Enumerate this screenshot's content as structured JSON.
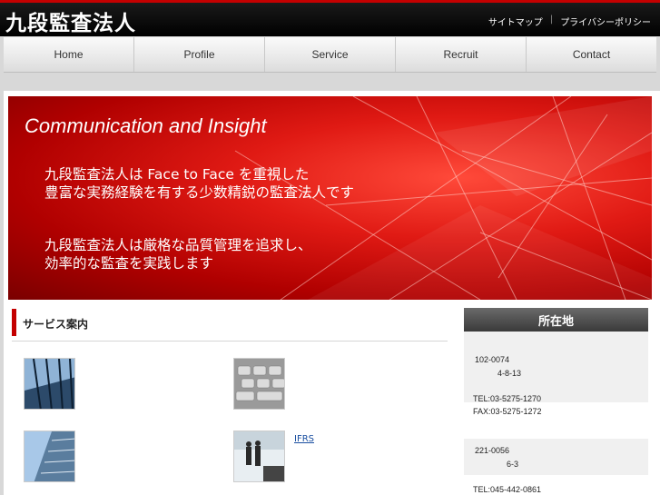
{
  "header": {
    "logo": "九段監査法人",
    "links": [
      "サイトマップ",
      "プライバシーポリシー"
    ]
  },
  "nav": [
    "Home",
    "Profile",
    "Service",
    "Recruit",
    "Contact"
  ],
  "hero": {
    "tagline": "Communication and Insight",
    "line1": "九段監査法人は Face to Face を重視した",
    "line2": "豊富な実務経験を有する少数精鋭の監査法人です",
    "line3": "九段監査法人は厳格な品質管理を追求し、",
    "line4": "効率的な監査を実践します"
  },
  "service": {
    "title": "サービス案内",
    "items": [
      {
        "label": "  "
      },
      {
        "label": "      "
      },
      {
        "label": "        "
      },
      {
        "label": "IFRS     "
      }
    ]
  },
  "location": {
    "title": "所在地",
    "office1": {
      "zip": "102-0074",
      "addr": "4-8-13",
      "tel": "TEL:03-5275-1270",
      "fax": "FAX:03-5275-1272"
    },
    "office2": {
      "zip": "221-0056",
      "addr": "6-3",
      "tel": "TEL:045-442-0861"
    }
  },
  "colors": {
    "accent": "#c40000",
    "link": "#1a4fa0"
  }
}
